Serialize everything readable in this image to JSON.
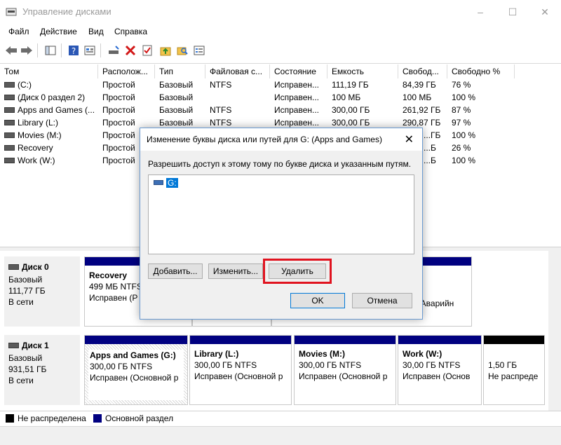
{
  "window": {
    "title": "Управление дисками",
    "minimize": "–",
    "maximize": "☐",
    "close": "✕"
  },
  "menu": [
    "Файл",
    "Действие",
    "Вид",
    "Справка"
  ],
  "table": {
    "columns": [
      "Том",
      "Располож...",
      "Тип",
      "Файловая с...",
      "Состояние",
      "Емкость",
      "Свобод...",
      "Свободно %"
    ],
    "rows": [
      [
        "(C:)",
        "Простой",
        "Базовый",
        "NTFS",
        "Исправен...",
        "111,19 ГБ",
        "84,39 ГБ",
        "76 %"
      ],
      [
        "(Диск 0 раздел 2)",
        "Простой",
        "Базовый",
        "",
        "Исправен...",
        "100 МБ",
        "100 МБ",
        "100 %"
      ],
      [
        "Apps and Games (...",
        "Простой",
        "Базовый",
        "NTFS",
        "Исправен...",
        "300,00 ГБ",
        "261,92 ГБ",
        "87 %"
      ],
      [
        "Library (L:)",
        "Простой",
        "Базовый",
        "NTFS",
        "Исправен...",
        "300,00 ГБ",
        "290,87 ГБ",
        "97 %"
      ],
      [
        "Movies (M:)",
        "Простой",
        "",
        "",
        "",
        "",
        "...ГБ",
        "100 %"
      ],
      [
        "Recovery",
        "Простой",
        "",
        "",
        "",
        "",
        "...Б",
        "26 %"
      ],
      [
        "Work (W:)",
        "Простой",
        "",
        "",
        "",
        "",
        "...Б",
        "100 %"
      ]
    ]
  },
  "disks": [
    {
      "name": "Диск 0",
      "type": "Базовый",
      "size": "111,77 ГБ",
      "status": "В сети",
      "partitions": [
        {
          "title": "Recovery",
          "size": "499 МБ NTFS",
          "status": "Исправен (Р"
        },
        {
          "title": "",
          "size": "",
          "status": ""
        },
        {
          "title": "",
          "size": "",
          "status": ""
        },
        {
          "title": "",
          "size": "",
          "status": ", Аварийн"
        }
      ]
    },
    {
      "name": "Диск 1",
      "type": "Базовый",
      "size": "931,51 ГБ",
      "status": "В сети",
      "partitions": [
        {
          "title": "Apps and Games  (G:)",
          "size": "300,00 ГБ NTFS",
          "status": "Исправен (Основной р"
        },
        {
          "title": "Library  (L:)",
          "size": "300,00 ГБ NTFS",
          "status": "Исправен (Основной р"
        },
        {
          "title": "Movies  (M:)",
          "size": "300,00 ГБ NTFS",
          "status": "Исправен (Основной р"
        },
        {
          "title": "Work  (W:)",
          "size": "30,00 ГБ NTFS",
          "status": "Исправен (Основ"
        },
        {
          "title": "",
          "size": "1,50 ГБ",
          "status": "Не распреде"
        }
      ]
    }
  ],
  "legend": [
    {
      "label": "Не распределена",
      "color": "#000000"
    },
    {
      "label": "Основной раздел",
      "color": "#000080"
    }
  ],
  "dialog": {
    "title": "Изменение буквы диска или путей для G: (Apps and Games)",
    "close": "✕",
    "description": "Разрешить доступ к этому тому по букве диска и указанным путям.",
    "list_items": [
      "G:"
    ],
    "add_button": "Добавить...",
    "change_button": "Изменить...",
    "delete_button": "Удалить",
    "ok_button": "OK",
    "cancel_button": "Отмена"
  },
  "colors": {
    "primary_partition": "#000080",
    "highlight": "#e0131f",
    "selection": "#0078d7"
  }
}
